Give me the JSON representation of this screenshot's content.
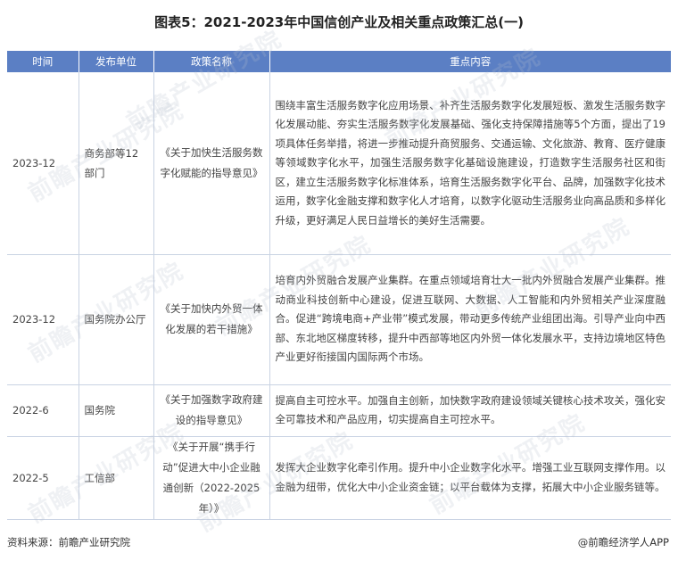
{
  "title": "图表5：2021-2023年中国信创产业及相关重点政策汇总(一)",
  "table": {
    "headers": [
      "时间",
      "发布单位",
      "政策名称",
      "重点内容"
    ],
    "rows": [
      {
        "time": "2023-12",
        "unit": "商务部等12部门",
        "name": "《关于加快生活服务数字化赋能的指导意见》",
        "content": "围绕丰富生活服务数字化应用场景、补齐生活服务数字化发展短板、激发生活服务数字化发展动能、夯实生活服务数字化发展基础、强化支持保障措施等5个方面，提出了19项具体任务举措，将进一步推动提升商贸服务、交通运输、文化旅游、教育、医疗健康等领域数字化水平，加强生活服务数字化基础设施建设，打造数字生活服务社区和街区，建立生活服务数字化标准体系，培育生活服务数字化平台、品牌，加强数字化技术运用，数字化金融支撑和数字化人才培育，以数字化驱动生活服务业向高品质和多样化升级，更好满足人民日益增长的美好生活需要。"
      },
      {
        "time": "2023-12",
        "unit": "国务院办公厅",
        "name": "《关于加快内外贸一体化发展的若干措施》",
        "content": "培育内外贸融合发展产业集群。在重点领域培育壮大一批内外贸融合发展产业集群。推动商业科技创新中心建设，促进互联网、大数据、人工智能和内外贸相关产业深度融合。促进“跨境电商+产业带”模式发展，带动更多传统产业组团出海。引导产业向中西部、东北地区梯度转移，提升中西部等地区内外贸一体化发展水平，支持边境地区特色产业更好衔接国内国际两个市场。"
      },
      {
        "time": "2022-6",
        "unit": "国务院",
        "name": "《关于加强数字政府建设的指导意见》",
        "content": "提高自主可控水平。加强自主创新，加快数字政府建设领域关键核心技术攻关，强化安全可靠技术和产品应用，切实提高自主可控水平。"
      },
      {
        "time": "2022-5",
        "unit": "工信部",
        "name": "《关于开展“携手行动”促进大中小企业融通创新（2022-2025年）》",
        "content": "发挥大企业数字化牵引作用。提升中小企业数字化水平。增强工业互联网支撑作用。以金融为纽带，优化大中小企业资金链；以平台载体为支撑，拓展大中小企业服务链等。"
      }
    ]
  },
  "footer": {
    "source": "资料来源：前瞻产业研究院",
    "brand": "@前瞻经济学人APP"
  },
  "watermark": "前瞻产业研究院",
  "colors": {
    "header_bg": "#5b7fc4",
    "border": "#c9d3e3"
  }
}
